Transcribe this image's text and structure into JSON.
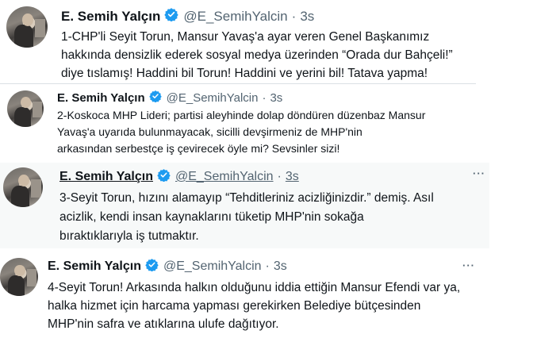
{
  "colors": {
    "text": "#0f1419",
    "secondary": "#536471",
    "verified": "#1d9bf0",
    "hover_background": "#f7f9f9"
  },
  "icons": {
    "verified": "verified-badge-icon",
    "more": "more-options-icon",
    "avatar": "profile-photo"
  },
  "tweets": [
    {
      "name": "E. Semih Yalçın",
      "handle": "@E_SemihYalcin",
      "dot": "·",
      "time": "3s",
      "lines": [
        "1-CHP'li Seyit Torun, Mansur Yavaş'a ayar veren Genel Başkanımız",
        "hakkında densizlik ederek sosyal medya üzerinden “Orada dur Bahçeli!”",
        "diye tıslamış! Haddini bil Torun! Haddini ve yerini bil! Tatava yapma!"
      ]
    },
    {
      "name": "E. Semih Yalçın",
      "handle": "@E_SemihYalcin",
      "dot": "·",
      "time": "3s",
      "lines": [
        "2-Koskoca MHP Lideri; partisi aleyhinde dolap döndüren düzenbaz Mansur",
        "Yavaş'a uyarıda bulunmayacak, sicilli devşirmeniz de MHP'nin",
        "arkasından serbestçe iş çevirecek öyle mi? Sevsinler sizi!"
      ]
    },
    {
      "name": "E. Semih Yalçın",
      "handle": "@E_SemihYalcin",
      "dot": "·",
      "time": "3s",
      "more": "···",
      "lines": [
        "3-Seyit Torun, hızını alamayıp “Tehditleriniz acizliğinizdir.” demiş. Asıl",
        "acizlik, kendi insan kaynaklarını tüketip MHP'nin sokağa",
        "bıraktıklarıyla iş tutmaktır."
      ]
    },
    {
      "name": "E. Semih Yalçın",
      "handle": "@E_SemihYalcin",
      "dot": "·",
      "time": "3s",
      "more": "···",
      "lines": [
        "4-Seyit Torun! Arkasında halkın olduğunu iddia ettiğin Mansur Efendi var ya,",
        "halka hizmet için harcama yapması gerekirken Belediye bütçesinden",
        "MHP'nin safra ve atıklarına ulufe dağıtıyor."
      ]
    }
  ]
}
